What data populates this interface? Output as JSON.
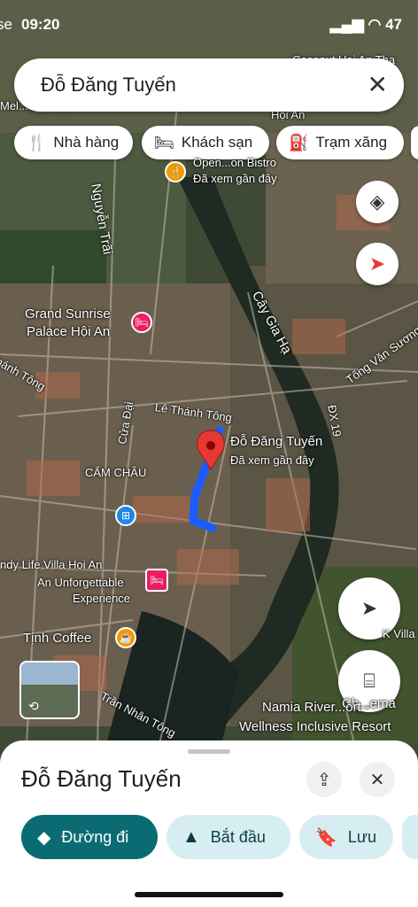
{
  "status_bar": {
    "time": "09:20",
    "left_fragment": "se",
    "battery": "47"
  },
  "search": {
    "query": "Đỗ Đăng Tuyến"
  },
  "chips": [
    {
      "label": "Nhà hàng",
      "icon": "fork-knife-icon"
    },
    {
      "label": "Khách sạn",
      "icon": "bed-icon"
    },
    {
      "label": "Trạm xăng",
      "icon": "gas-pump-icon"
    }
  ],
  "map_labels": {
    "grand_sunrise": "Grand Sunrise",
    "palace": "Palace Hội An",
    "le_thanh_tong": "Lê Thánh Tông",
    "dest_name": "Đỗ Đăng Tuyến",
    "dest_sub": "Đã xem gần đây",
    "cam_chau": "CẨM CHÂU",
    "cua_dai": "Cửa Đại",
    "cay_gia_ha": "Cây Gia Hạ",
    "tong_van_suong": "Tống Văn Sương",
    "nguyen_trai": "Nguyễn Trãi",
    "dx19": "ĐX 19",
    "thanh_tong_left": "hánh Tông",
    "ndy_life": "ndy Life Villa Hoi An",
    "unforgettable": "An Unforgettable",
    "experience": "Experience",
    "tinh_coffee": "Tịnh Coffee",
    "tran_nhan_tong": "Trần Nhân Tông",
    "namia": "Namia River...ort -",
    "wellness": "Wellness Inclusive Resort",
    "chema": "Ch...ema",
    "k_villa": "K Villa",
    "open_bistro": "Open...on Bistro",
    "open_bistro_sub": "Đã xem gần đây",
    "hoi_an_top": "Hội An",
    "top_right": "Coconut Hoi An Tha",
    "top_left": "Mel...ouly R..."
  },
  "colors": {
    "route": "#1a5cff",
    "pin": "#e53935",
    "action_primary": "#0b6b73",
    "action_secondary": "#d6eef1"
  },
  "sheet": {
    "title": "Đỗ Đăng Tuyến",
    "actions": [
      {
        "label": "Đường đi",
        "icon": "directions-icon"
      },
      {
        "label": "Bắt đầu",
        "icon": "navigation-arrow-icon"
      },
      {
        "label": "Lưu",
        "icon": "bookmark-icon"
      }
    ]
  }
}
